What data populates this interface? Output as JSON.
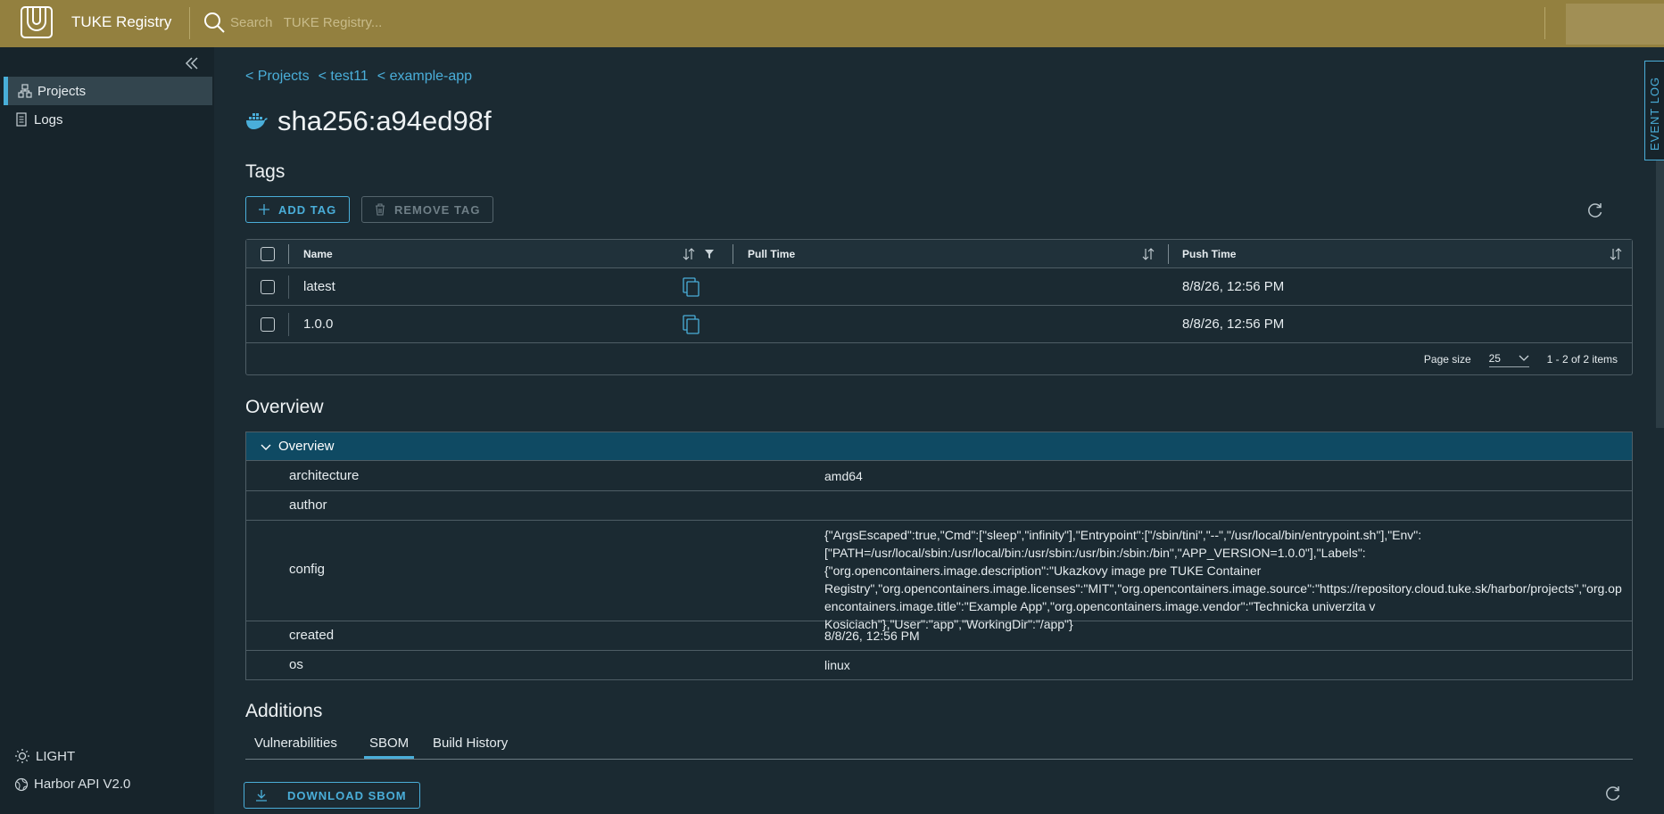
{
  "header": {
    "app_title": "TUKE Registry",
    "search_placeholder": "Search   TUKE Registry..."
  },
  "sidebar": {
    "items": [
      {
        "label": "Projects",
        "icon": "projects-icon",
        "active": true
      },
      {
        "label": "Logs",
        "icon": "logs-icon",
        "active": false
      }
    ],
    "theme_label": "LIGHT",
    "api_label": "Harbor API V2.0"
  },
  "breadcrumb": [
    "< Projects",
    "< test11",
    "< example-app"
  ],
  "page_title": "sha256:a94ed98f",
  "tags": {
    "title": "Tags",
    "add_label": "ADD TAG",
    "remove_label": "REMOVE TAG",
    "columns": [
      "Name",
      "Pull Time",
      "Push Time"
    ],
    "rows": [
      {
        "name": "latest",
        "pull_time": "",
        "push_time": "8/8/26, 12:56 PM"
      },
      {
        "name": "1.0.0",
        "pull_time": "",
        "push_time": "8/8/26, 12:56 PM"
      }
    ],
    "page_size_label": "Page size",
    "page_size": "25",
    "pagination": "1 - 2 of 2 items"
  },
  "overview": {
    "title": "Overview",
    "panel_label": "Overview",
    "rows": [
      {
        "key": "architecture",
        "value": "amd64"
      },
      {
        "key": "author",
        "value": ""
      },
      {
        "key": "config",
        "value": "{\"ArgsEscaped\":true,\"Cmd\":[\"sleep\",\"infinity\"],\"Entrypoint\":[\"/sbin/tini\",\"--\",\"/usr/local/bin/entrypoint.sh\"],\"Env\":[\"PATH=/usr/local/sbin:/usr/local/bin:/usr/sbin:/usr/bin:/sbin:/bin\",\"APP_VERSION=1.0.0\"],\"Labels\":{\"org.opencontainers.image.description\":\"Ukazkovy image pre TUKE Container Registry\",\"org.opencontainers.image.licenses\":\"MIT\",\"org.opencontainers.image.source\":\"https://repository.cloud.tuke.sk/harbor/projects\",\"org.opencontainers.image.title\":\"Example App\",\"org.opencontainers.image.vendor\":\"Technicka univerzita v Kosiciach\"},\"User\":\"app\",\"WorkingDir\":\"/app\"}"
      },
      {
        "key": "created",
        "value": "8/8/26, 12:56 PM"
      },
      {
        "key": "os",
        "value": "linux"
      }
    ]
  },
  "additions": {
    "title": "Additions",
    "tabs": [
      "Vulnerabilities",
      "SBOM",
      "Build History"
    ],
    "active_tab": "SBOM",
    "download_label": "DOWNLOAD SBOM"
  },
  "event_log_label": "EVENT LOG",
  "colors": {
    "header": "#93803f",
    "accent": "#4aaed9",
    "background": "#1b2a32"
  }
}
